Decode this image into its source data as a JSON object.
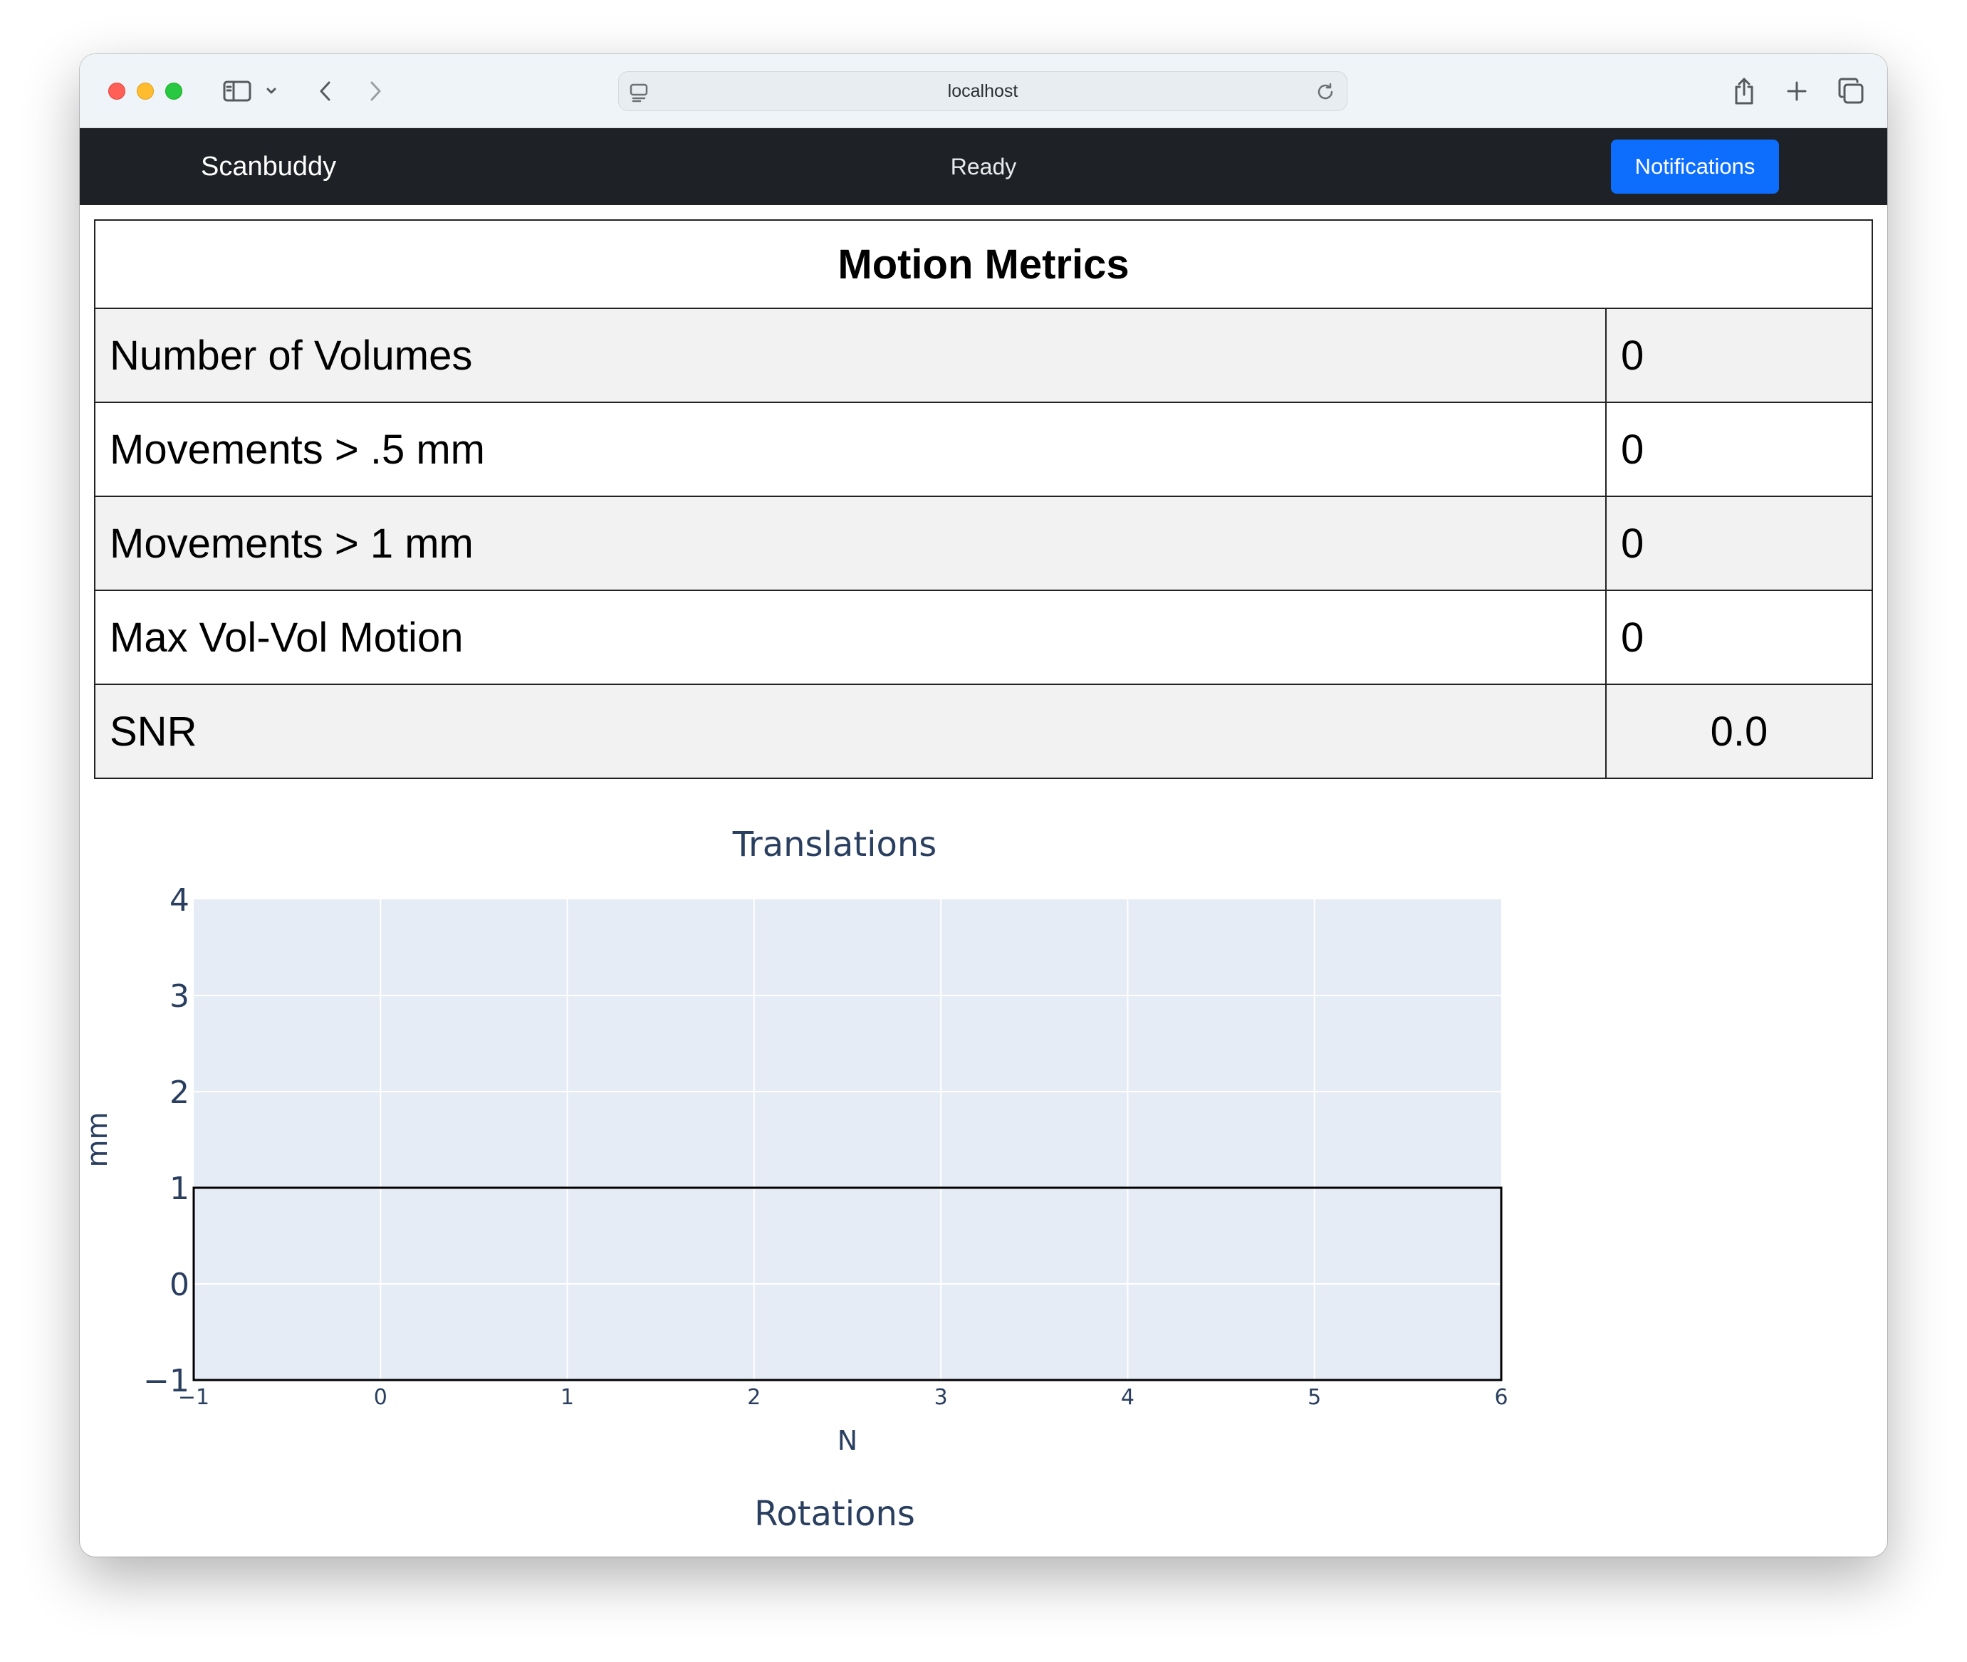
{
  "browser": {
    "url": "localhost",
    "icons": [
      "sidebar-icon",
      "chevron-down-icon",
      "back-icon",
      "forward-icon",
      "site-icon",
      "reload-icon",
      "share-icon",
      "new-tab-icon",
      "tabs-overview-icon"
    ]
  },
  "navbar": {
    "brand": "Scanbuddy",
    "status": "Ready",
    "notifications_label": "Notifications",
    "bg_color": "#1e2125",
    "button_color": "#0d6efd"
  },
  "metrics": {
    "title": "Motion Metrics",
    "rows": [
      {
        "label": "Number of Volumes",
        "value": "0"
      },
      {
        "label": "Movements > .5 mm",
        "value": "0"
      },
      {
        "label": "Movements > 1 mm",
        "value": "0"
      },
      {
        "label": "Max Vol-Vol Motion",
        "value": "0"
      },
      {
        "label": "SNR",
        "value": "0.0"
      }
    ]
  },
  "charts": {
    "translations_title": "Translations",
    "rotations_title": "Rotations"
  },
  "chart_data": [
    {
      "type": "line",
      "title": "Translations",
      "xlabel": "N",
      "ylabel": "mm",
      "xlim": [
        -1,
        6
      ],
      "ylim": [
        -1,
        4
      ],
      "x_ticks": [
        -1,
        0,
        1,
        2,
        3,
        4,
        5,
        6
      ],
      "y_ticks": [
        -1,
        0,
        1,
        2,
        3,
        4
      ],
      "x_tick_labels": [
        "−1",
        "0",
        "1",
        "2",
        "3",
        "4",
        "5",
        "6"
      ],
      "y_tick_labels": [
        "−1",
        "0",
        "1",
        "2",
        "3",
        "4"
      ],
      "grid": true,
      "plot_bg": "#e5ecf6",
      "shapes": [
        {
          "type": "rect",
          "x0": -1,
          "x1": 6,
          "y0": -1,
          "y1": 1,
          "line_color": "#000000"
        }
      ],
      "series": []
    },
    {
      "type": "line",
      "title": "Rotations"
    }
  ]
}
